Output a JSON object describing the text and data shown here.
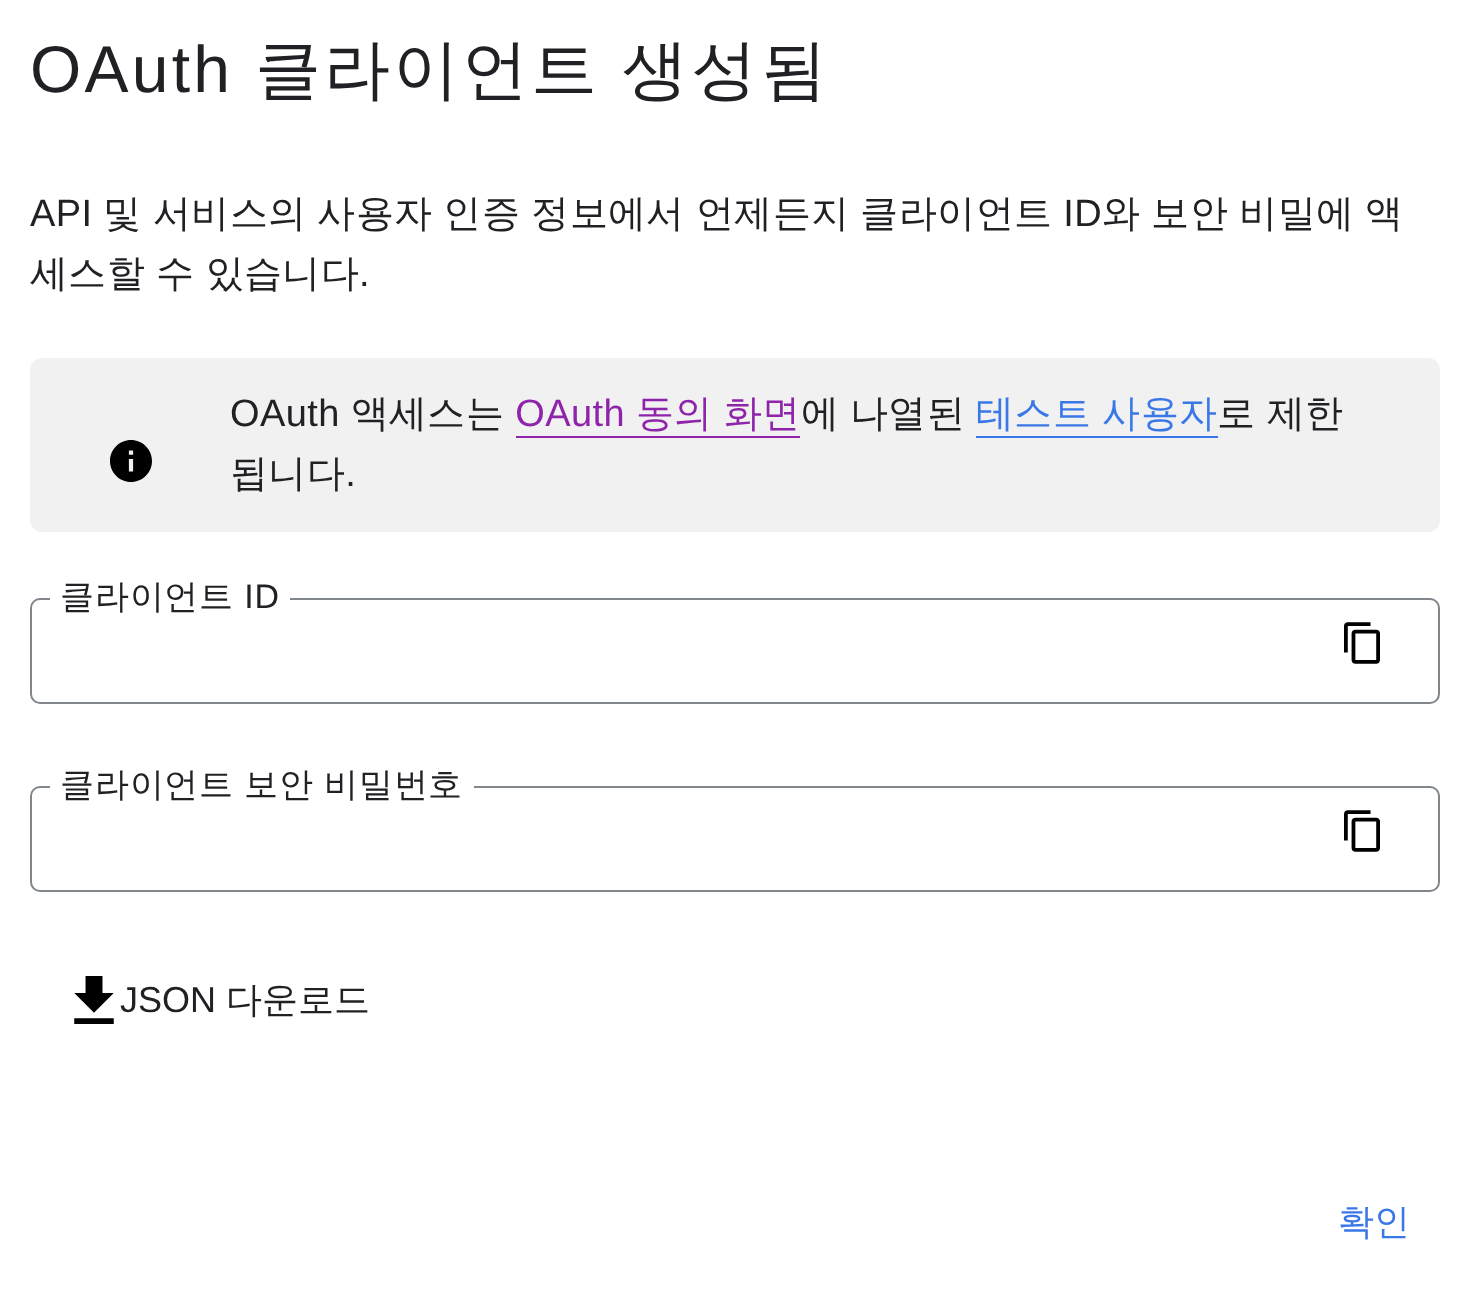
{
  "title": "OAuth 클라이언트 생성됨",
  "description": "API 및 서비스의 사용자 인증 정보에서 언제든지 클라이언트 ID와 보안 비밀에 액세스할 수 있습니다.",
  "notice": {
    "parts": [
      {
        "kind": "text",
        "text": "OAuth 액세스는 "
      },
      {
        "kind": "link",
        "text": "OAuth 동의 화면",
        "visited": true
      },
      {
        "kind": "text",
        "text": "에 나열된 "
      },
      {
        "kind": "link",
        "text": "테스트 사용자",
        "visited": false
      },
      {
        "kind": "text",
        "text": "로 제한됩니다."
      }
    ]
  },
  "fields": [
    {
      "label": "클라이언트 ID"
    },
    {
      "label": "클라이언트 보안 비밀번호"
    }
  ],
  "download_button": "JSON 다운로드",
  "confirm_button": "확인"
}
